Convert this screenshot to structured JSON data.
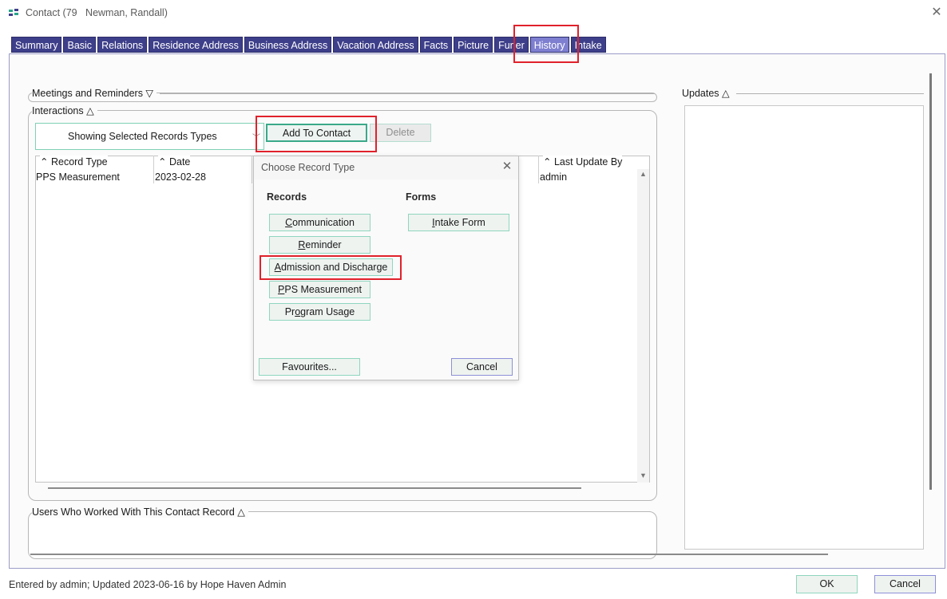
{
  "window": {
    "title": "Contact (79   Newman, Randall)",
    "close_icon": "close-icon"
  },
  "tabs": [
    {
      "label": "Summary"
    },
    {
      "label": "Basic"
    },
    {
      "label": "Relations"
    },
    {
      "label": "Residence Address"
    },
    {
      "label": "Business Address"
    },
    {
      "label": "Vacation Address"
    },
    {
      "label": "Facts"
    },
    {
      "label": "Picture"
    },
    {
      "label": "Funer"
    },
    {
      "label": "History",
      "active": true
    },
    {
      "label": "Intake"
    }
  ],
  "sections": {
    "meetings": "Meetings and Reminders ▽",
    "interactions": "Interactions △",
    "users": "Users Who Worked With This Contact Record △",
    "updates": "Updates △"
  },
  "interactions": {
    "filter_value": "Showing Selected Records Types",
    "add_button": "Add To Contact",
    "delete_button": "Delete",
    "columns": [
      "Record Type",
      "Date",
      "Last Update By"
    ],
    "rows": [
      {
        "record_type": "PPS Measurement",
        "date": "2023-02-28",
        "last_update_by": "admin"
      }
    ]
  },
  "dialog": {
    "title": "Choose Record Type",
    "records_heading": "Records",
    "forms_heading": "Forms",
    "records": [
      {
        "mnemonic": "C",
        "rest": "ommunication"
      },
      {
        "mnemonic": "R",
        "rest": "eminder"
      },
      {
        "mnemonic": "A",
        "rest": "dmission and Discharge"
      },
      {
        "mnemonic": "P",
        "rest": "PS Measurement"
      },
      {
        "pre": "Pr",
        "mnemonic": "o",
        "rest": "gram Usage"
      }
    ],
    "forms": [
      {
        "pre": "",
        "mnemonic": "I",
        "rest": "ntake Form"
      }
    ],
    "favourites_button": "Favourites...",
    "cancel_button": "Cancel"
  },
  "footer": {
    "status": "Entered by admin; Updated 2023-06-16 by Hope Haven Admin",
    "ok_button": "OK",
    "cancel_button": "Cancel"
  },
  "colors": {
    "tab_bg": "#3e3f8a",
    "tab_active_bg": "#7e7fd0",
    "button_border": "#8fd6bf",
    "highlight": "#e0212b"
  }
}
